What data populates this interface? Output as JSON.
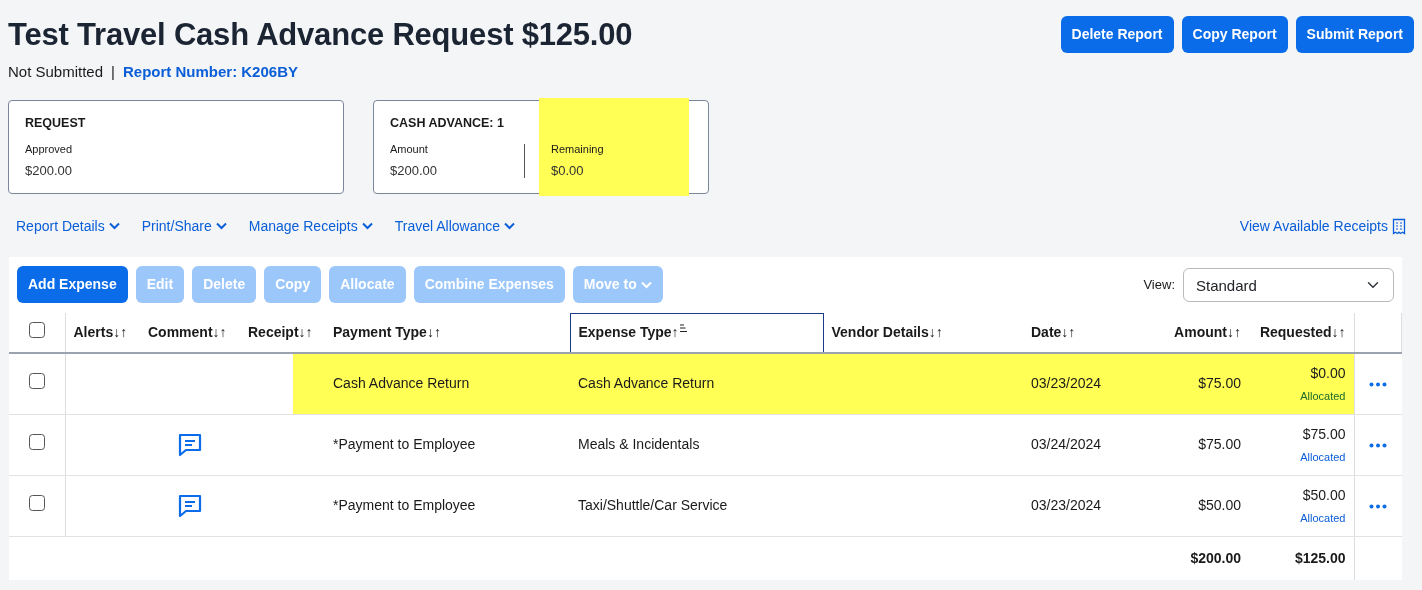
{
  "header": {
    "title": "Test Travel Cash Advance Request $125.00",
    "status": "Not Submitted",
    "separator": "|",
    "report_number": "Report Number: K206BY",
    "buttons": [
      "Delete Report",
      "Copy Report",
      "Submit Report"
    ]
  },
  "summary_cards": [
    {
      "title": "REQUEST",
      "items": [
        {
          "label": "Approved",
          "value": "$200.00",
          "highlighted": false
        }
      ]
    },
    {
      "title": "CASH ADVANCE: 1",
      "items": [
        {
          "label": "Amount",
          "value": "$200.00",
          "highlighted": false
        },
        {
          "label": "Remaining",
          "value": "$0.00",
          "highlighted": true
        }
      ]
    }
  ],
  "menus": [
    "Report Details",
    "Print/Share",
    "Manage Receipts",
    "Travel Allowance"
  ],
  "receipts_link": "View Available Receipts",
  "toolbar": [
    {
      "label": "Add Expense",
      "disabled": false,
      "dropdown": false
    },
    {
      "label": "Edit",
      "disabled": true,
      "dropdown": false
    },
    {
      "label": "Delete",
      "disabled": true,
      "dropdown": false
    },
    {
      "label": "Copy",
      "disabled": true,
      "dropdown": false
    },
    {
      "label": "Allocate",
      "disabled": true,
      "dropdown": false
    },
    {
      "label": "Combine Expenses",
      "disabled": true,
      "dropdown": false
    },
    {
      "label": "Move to",
      "disabled": true,
      "dropdown": true
    }
  ],
  "view": {
    "label": "View:",
    "value": "Standard"
  },
  "table": {
    "select_all_checked": false,
    "columns": [
      {
        "label": "Alerts↓↑",
        "kind": "text",
        "sorted": false
      },
      {
        "label": "Comment↓↑",
        "kind": "text",
        "sorted": false
      },
      {
        "label": "Receipt↓↑",
        "kind": "text",
        "sorted": false
      },
      {
        "label": "Payment Type↓↑",
        "kind": "text",
        "sorted": false
      },
      {
        "label": "Expense Type↑",
        "kind": "text",
        "sorted": true
      },
      {
        "label": "Vendor Details↓↑",
        "kind": "text",
        "sorted": false
      },
      {
        "label": "Date↓↑",
        "kind": "text",
        "sorted": false
      },
      {
        "label": "Amount↓↑",
        "kind": "money",
        "sorted": false
      },
      {
        "label": "Requested↓↑",
        "kind": "money",
        "sorted": false
      }
    ],
    "rows": [
      {
        "checked": false,
        "highlighted": true,
        "comment": false,
        "payment_type": "Cash Advance Return",
        "expense_type": "Cash Advance Return",
        "date": "03/23/2024",
        "amount": "$75.00",
        "requested": "$0.00",
        "requested_status": "Allocated"
      },
      {
        "checked": false,
        "highlighted": false,
        "comment": true,
        "payment_type": "*Payment to Employee",
        "expense_type": "Meals & Incidentals",
        "date": "03/24/2024",
        "amount": "$75.00",
        "requested": "$75.00",
        "requested_status": "Allocated"
      },
      {
        "checked": false,
        "highlighted": false,
        "comment": true,
        "payment_type": "*Payment to Employee",
        "expense_type": "Taxi/Shuttle/Car Service",
        "date": "03/23/2024",
        "amount": "$50.00",
        "requested": "$50.00",
        "requested_status": "Allocated"
      }
    ],
    "totals": {
      "amount": "$200.00",
      "requested": "$125.00"
    }
  }
}
